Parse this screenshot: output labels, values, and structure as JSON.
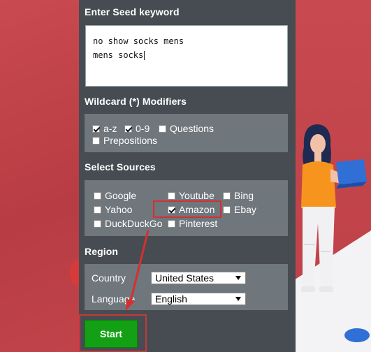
{
  "seed": {
    "heading": "Enter Seed keyword",
    "lines": [
      "no show socks mens",
      "mens socks"
    ]
  },
  "wildcard": {
    "heading": "Wildcard (*) Modifiers",
    "options": [
      {
        "label": "a-z",
        "checked": true
      },
      {
        "label": "0-9",
        "checked": true
      },
      {
        "label": "Questions",
        "checked": false
      },
      {
        "label": "Prepositions",
        "checked": false
      }
    ]
  },
  "sources": {
    "heading": "Select Sources",
    "options": [
      {
        "label": "Google",
        "checked": false
      },
      {
        "label": "Youtube",
        "checked": false
      },
      {
        "label": "Bing",
        "checked": false
      },
      {
        "label": "Yahoo",
        "checked": false
      },
      {
        "label": "Amazon",
        "checked": true
      },
      {
        "label": "Ebay",
        "checked": false
      },
      {
        "label": "DuckDuckGo",
        "checked": false
      },
      {
        "label": "Pinterest",
        "checked": false
      }
    ]
  },
  "region": {
    "heading": "Region",
    "country_label": "Country",
    "country_value": "United States",
    "language_label": "Language",
    "language_value": "English"
  },
  "actions": {
    "start_label": "Start"
  },
  "colors": {
    "panel": "#464c52",
    "box": "#6f767c",
    "start": "#14a014",
    "highlight": "#d62f2f",
    "background": "#c4474c"
  }
}
